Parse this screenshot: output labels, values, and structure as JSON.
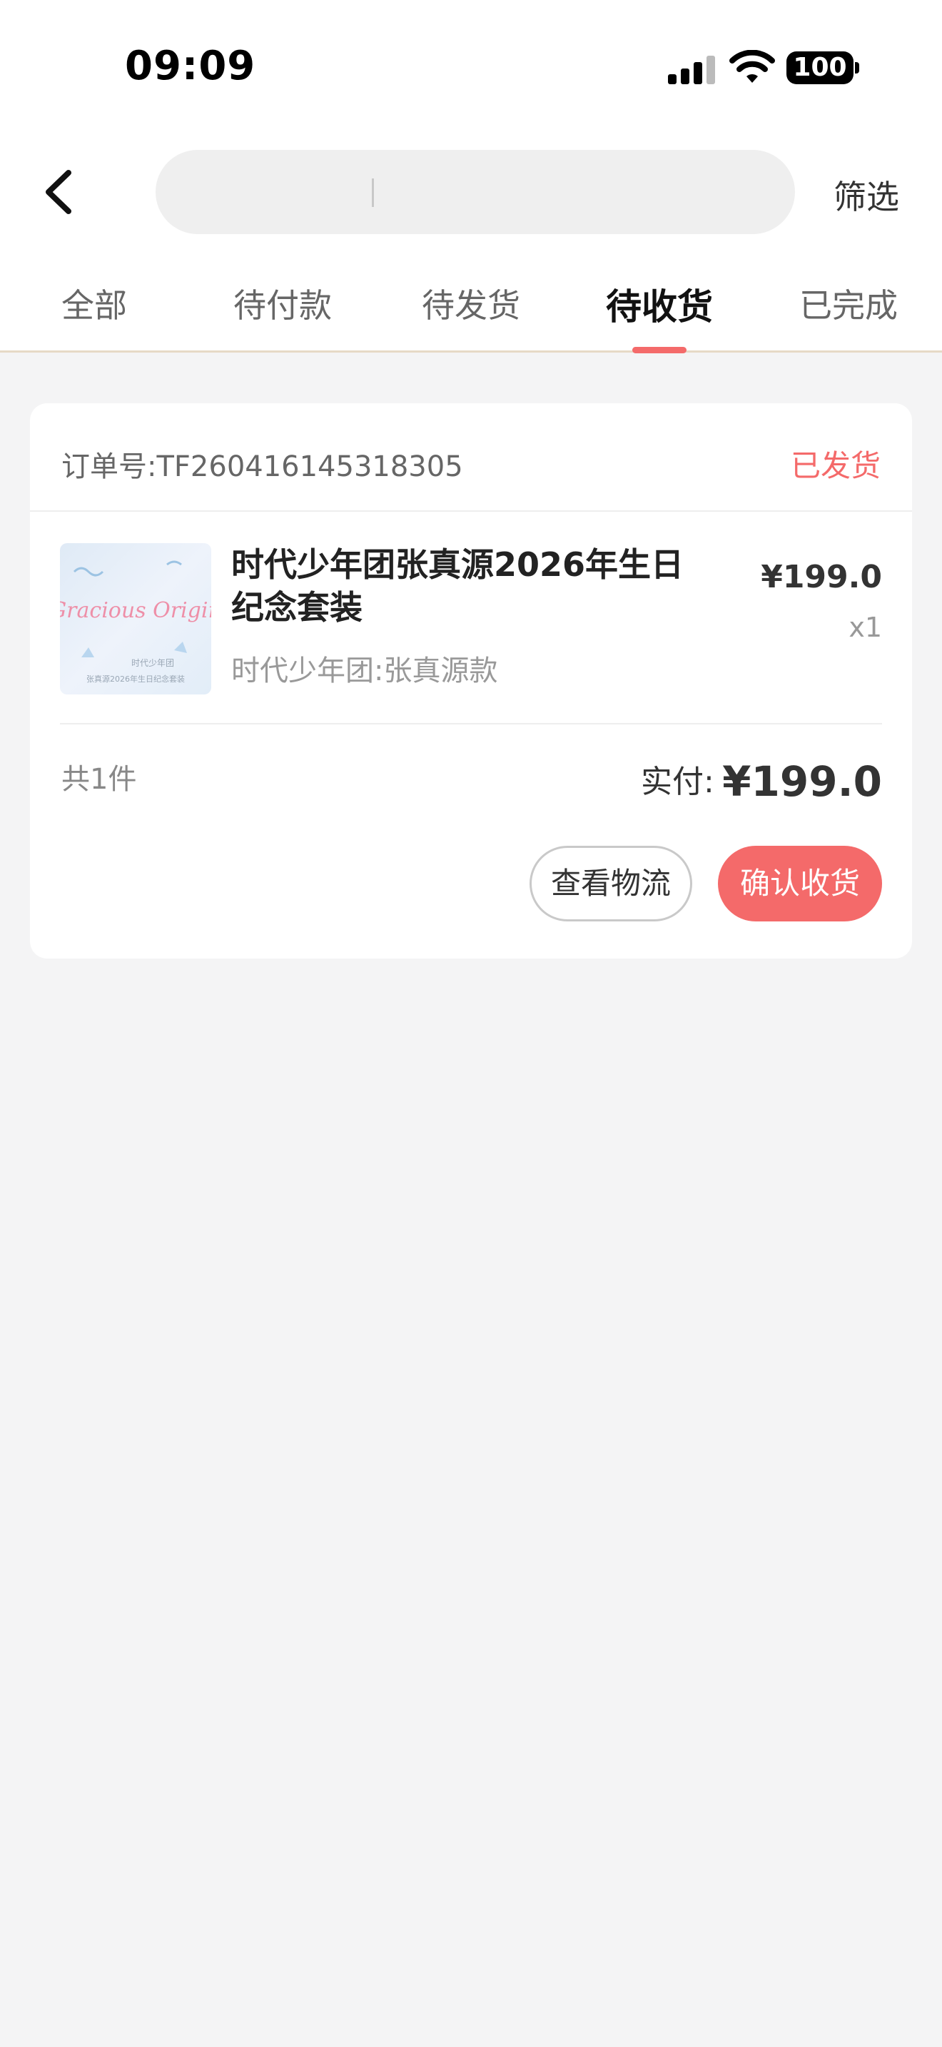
{
  "status_bar": {
    "time": "09:09",
    "battery": "100"
  },
  "header": {
    "search_value": "",
    "filter_label": "筛选"
  },
  "tabs": [
    {
      "label": "全部"
    },
    {
      "label": "待付款"
    },
    {
      "label": "待发货"
    },
    {
      "label": "待收货"
    },
    {
      "label": "已完成"
    }
  ],
  "order": {
    "order_no": "订单号:TF260416145318305",
    "status": "已发货",
    "item": {
      "title": "时代少年团张真源2026年生日纪念套装",
      "spec": "时代少年团:张真源款",
      "price": "¥199.0",
      "qty": "x1",
      "thumb_text_main": "Gracious Origin",
      "thumb_text_sub1": "时代少年团",
      "thumb_text_sub2": "张真源2026年生日纪念套装"
    },
    "count": "共1件",
    "paid_label": "实付:",
    "paid_value": "¥199.0",
    "buttons": {
      "logistics": "查看物流",
      "confirm": "确认收货"
    }
  },
  "colors": {
    "accent": "#f46a6a",
    "page_bg": "#f4f4f5",
    "card_bg": "#ffffff"
  }
}
